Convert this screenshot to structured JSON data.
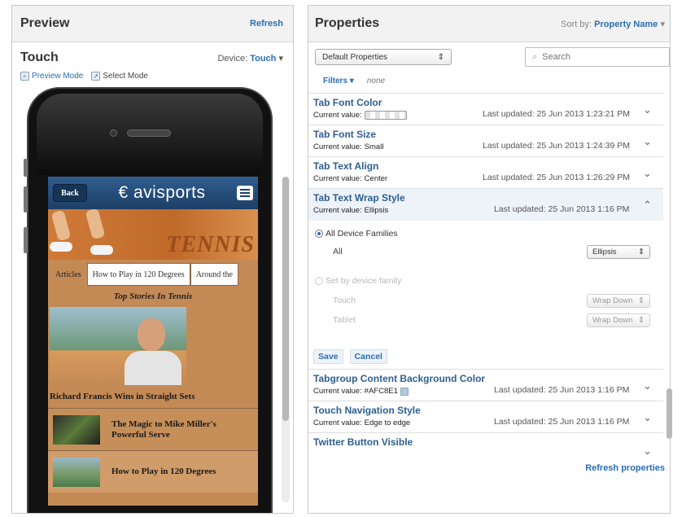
{
  "preview": {
    "title": "Preview",
    "refresh": "Refresh",
    "device_name": "Touch",
    "device_label": "Device:",
    "device_value": "Touch",
    "preview_mode": "Preview Mode",
    "select_mode": "Select Mode"
  },
  "app": {
    "back": "Back",
    "logo": "€ avisports",
    "banner_word": "TENNIS",
    "tabs": [
      "Articles",
      "How to Play in 120 Degrees",
      "Around the"
    ],
    "section_title": "Top Stories In Tennis",
    "hero_caption": "Richard Francis Wins in Straight Sets",
    "stories": [
      "The Magic to Mike Miller's Powerful Serve",
      "How to Play in 120 Degrees"
    ]
  },
  "properties": {
    "title": "Properties",
    "sort_label": "Sort by:",
    "sort_value": "Property Name",
    "filter_select": "Default Properties",
    "search_placeholder": "Search",
    "filters_label": "Filters",
    "filters_value": "none",
    "current_value_prefix": "Current value:",
    "rows": [
      {
        "name": "Tab Font Color",
        "value": "",
        "updated": "Last updated: 25 Jun 2013 1:23:21 PM"
      },
      {
        "name": "Tab Font Size",
        "value": "Small",
        "updated": "Last updated: 25 Jun 2013 1:24:39 PM"
      },
      {
        "name": "Tab Text Align",
        "value": "Center",
        "updated": "Last updated: 25 Jun 2013 1:26:29 PM"
      },
      {
        "name": "Tab Text Wrap Style",
        "value": "Ellipsis",
        "updated": "Last updated: 25 Jun 2013 1:16 PM"
      },
      {
        "name": "Tabgroup Content Background Color",
        "value": "#AFC8E1",
        "updated": "Last updated: 25 Jun 2013 1:16 PM"
      },
      {
        "name": "Touch Navigation Style",
        "value": "Edge to edge",
        "updated": "Last updated: 25 Jun 2013 1:16 PM"
      },
      {
        "name": "Twitter Button Visible",
        "value": "",
        "updated": ""
      }
    ],
    "editor": {
      "all_families": "All Device Families",
      "all": "All",
      "all_value": "Ellipsis",
      "by_family": "Set by device family",
      "touch": "Touch",
      "touch_value": "Wrap Down",
      "tablet": "Tablet",
      "tablet_value": "Wrap Down",
      "save": "Save",
      "cancel": "Cancel"
    },
    "refresh_properties": "Refresh properties"
  },
  "colors": {
    "link": "#2a6db5",
    "swatch": "#AFC8E1",
    "app_bar": "#1d3f66",
    "app_bg": "#c48a55"
  }
}
